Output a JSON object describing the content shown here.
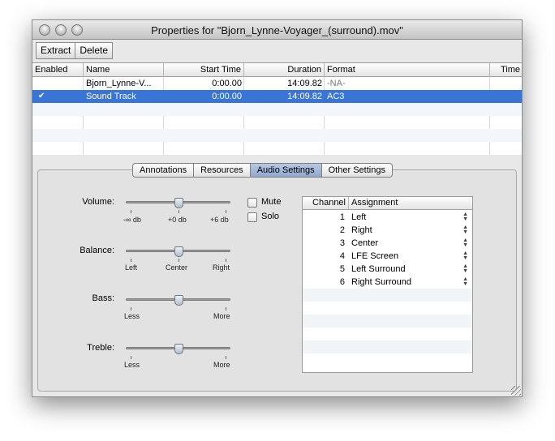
{
  "window": {
    "title": "Properties for \"Bjorn_Lynne-Voyager_(surround).mov\""
  },
  "toolbar": {
    "extract_label": "Extract",
    "delete_label": "Delete"
  },
  "tracks_table": {
    "headers": [
      "Enabled",
      "Name",
      "Start Time",
      "Duration",
      "Format",
      "Time"
    ],
    "rows": [
      {
        "enabled": "",
        "name": "Bjorn_Lynne-V...",
        "start": "0:00.00",
        "duration": "14:09.82",
        "format": "-NA-",
        "selected": false
      },
      {
        "enabled": "✔",
        "name": "Sound Track",
        "start": "0:00.00",
        "duration": "14:09.82",
        "format": "AC3",
        "selected": true
      }
    ]
  },
  "tabs": [
    {
      "label": "Annotations",
      "active": false
    },
    {
      "label": "Resources",
      "active": false
    },
    {
      "label": "Audio Settings",
      "active": true
    },
    {
      "label": "Other Settings",
      "active": false
    }
  ],
  "audio": {
    "volume": {
      "label": "Volume:",
      "min": "-∞ db",
      "mid": "+0 db",
      "max": "+6 db",
      "value_fraction": 0.5
    },
    "balance": {
      "label": "Balance:",
      "min": "Left",
      "mid": "Center",
      "max": "Right",
      "value_fraction": 0.5
    },
    "bass": {
      "label": "Bass:",
      "min": "Less",
      "max": "More",
      "value_fraction": 0.5
    },
    "treble": {
      "label": "Treble:",
      "min": "Less",
      "max": "More",
      "value_fraction": 0.5
    },
    "mute_label": "Mute",
    "solo_label": "Solo"
  },
  "channels": {
    "headers": [
      "Channel",
      "Assignment"
    ],
    "rows": [
      {
        "channel": "1",
        "assignment": "Left"
      },
      {
        "channel": "2",
        "assignment": "Right"
      },
      {
        "channel": "3",
        "assignment": "Center"
      },
      {
        "channel": "4",
        "assignment": "LFE Screen"
      },
      {
        "channel": "5",
        "assignment": "Left Surround"
      },
      {
        "channel": "6",
        "assignment": "Right Surround"
      }
    ]
  },
  "colors": {
    "selection": "#3875d7",
    "active_tab": "#9fb6d8"
  }
}
